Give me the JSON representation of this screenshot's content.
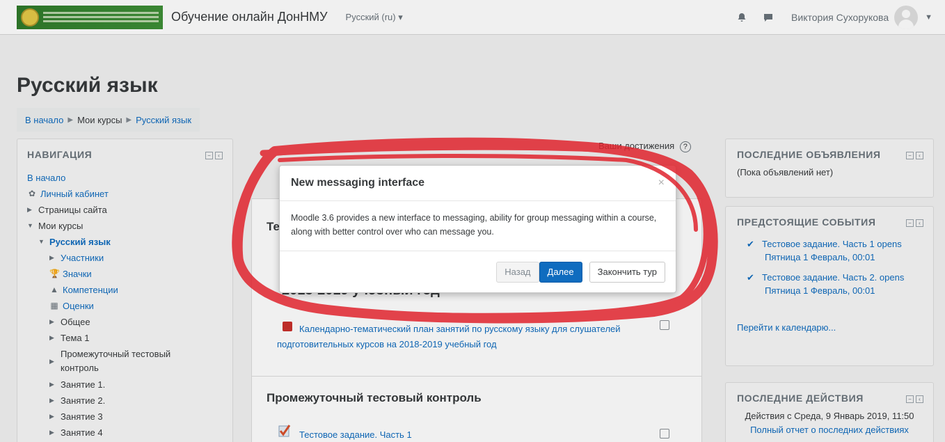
{
  "navbar": {
    "site_name": "Обучение онлайн ДонНМУ",
    "language": "Русский (ru) ▾",
    "user_name": "Виктория Сухорукова",
    "icons": [
      "bell-icon",
      "chat-icon"
    ]
  },
  "page": {
    "title": "Русский язык",
    "breadcrumb": [
      "В начало",
      "Мои курсы",
      "Русский язык"
    ]
  },
  "navigation": {
    "title": "НАВИГАЦИЯ",
    "items": [
      {
        "label": "В начало"
      },
      {
        "label": "Личный кабинет"
      },
      {
        "label": "Страницы сайта"
      },
      {
        "label": "Мои курсы"
      },
      {
        "label": "Русский язык"
      },
      {
        "label": "Участники"
      },
      {
        "label": "Значки"
      },
      {
        "label": "Компетенции"
      },
      {
        "label": "Оценки"
      },
      {
        "label": "Общее"
      },
      {
        "label": "Тема 1"
      },
      {
        "label": "Промежуточный тестовый контроль"
      },
      {
        "label": "Занятие 1."
      },
      {
        "label": "Занятие 2."
      },
      {
        "label": "Занятие 3"
      },
      {
        "label": "Занятие 4"
      }
    ]
  },
  "main": {
    "achievements": "Ваши достижения",
    "section_partial": "Те",
    "section_year": "2018-2019 учебный год",
    "calendar_link": "Календарно-тематический план занятий по русскому языку для слушателей подготовительных курсов на 2018-2019 учебный год",
    "section2_title": "Промежуточный тестовый контроль",
    "quiz_link": "Тестовое задание. Часть 1"
  },
  "announcements": {
    "title": "ПОСЛЕДНИЕ ОБЪЯВЛЕНИЯ",
    "empty": "(Пока объявлений нет)"
  },
  "events": {
    "title": "ПРЕДСТОЯЩИЕ СОБЫТИЯ",
    "items": [
      {
        "label": "Тестовое задание. Часть 1 opens",
        "time": "Пятница 1 Февраль, 00:01"
      },
      {
        "label": "Тестовое задание. Часть 2. opens",
        "time": "Пятница 1 Февраль, 00:01"
      }
    ],
    "calendar_link": "Перейти к календарю..."
  },
  "recent": {
    "title": "ПОСЛЕДНИЕ ДЕЙСТВИЯ",
    "since": "Действия с Среда, 9 Январь 2019, 11:50",
    "full_report": "Полный отчет о последних действиях"
  },
  "modal": {
    "title": "New messaging interface",
    "close": "×",
    "body": "Moodle 3.6 provides a new interface to messaging, ability for group messaging within a course, along with better control over who can message you.",
    "prev": "Назад",
    "next": "Далее",
    "end": "Закончить тур"
  },
  "colors": {
    "link": "#0f6cbf",
    "primary_button": "#0f6cbf",
    "scribble": "#e0242e"
  }
}
